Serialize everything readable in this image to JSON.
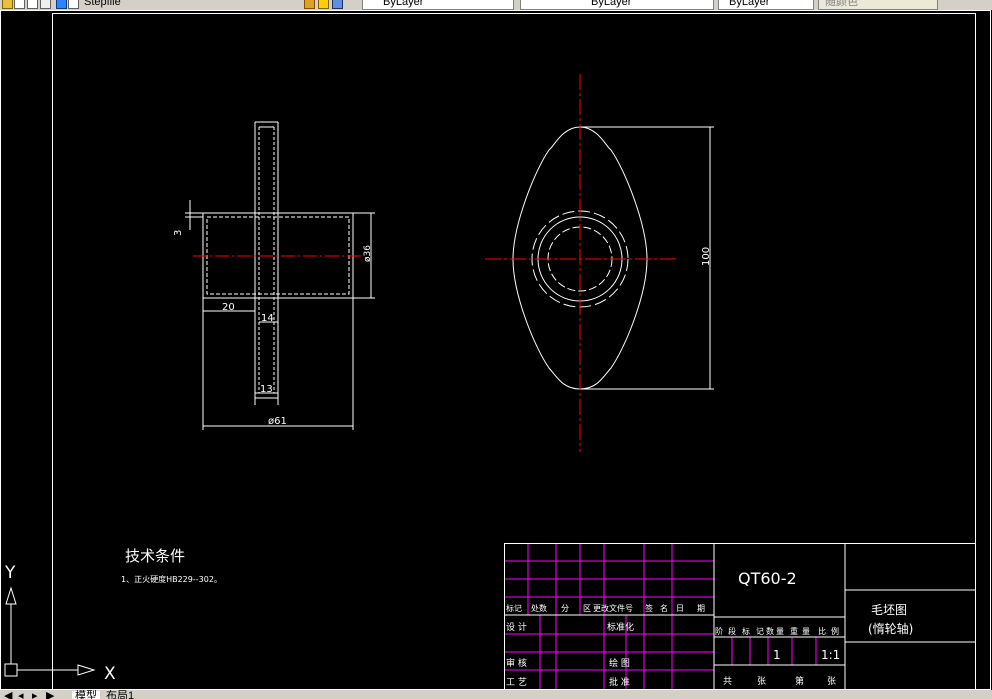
{
  "toolbar": {
    "file_name": "Stepfile",
    "layer_value": "ByLayer",
    "linetype_value": "ByLayer",
    "lineweight_value": "ByLayer",
    "plotstyle_value": "随颜色"
  },
  "drawing": {
    "dim_flange_thickness": "3",
    "dim_diameter_36": "ø36",
    "dim_20": "20",
    "dim_14": "14",
    "dim_13": "13",
    "dim_diameter_61": "ø61",
    "dim_100": "100"
  },
  "notes": {
    "heading": "技术条件",
    "item_1": "1、正火硬度HB229--302。"
  },
  "title_block": {
    "material": "QT60-2",
    "drawing_name": "毛坯图",
    "part_name": "(惰轮轴)",
    "row_header": [
      "标记",
      "处数",
      "分",
      "区",
      "更改文件号",
      "签",
      "名",
      "日",
      "期"
    ],
    "label_design": "设 计",
    "label_standard": "标准化",
    "label_review": "审 核",
    "label_drawing": "绘 图",
    "label_process": "工 艺",
    "label_approve": "批 准",
    "stage_headers": [
      "阶",
      "段",
      "标",
      "记",
      "数",
      "量",
      "重",
      "量",
      "比",
      "例"
    ],
    "quantity": "1",
    "scale": "1:1",
    "sheets_total_label": "共",
    "sheets_unit_1": "张",
    "sheet_no_label": "第",
    "sheets_unit_2": "张"
  },
  "ucs": {
    "x_label": "X",
    "y_label": "Y"
  },
  "tabs": [
    "模型",
    "布局1"
  ],
  "colors": {
    "background": "#000000",
    "lines": "#ffffff",
    "centerline": "#ff0000",
    "title_grid": "#ff00ff"
  }
}
